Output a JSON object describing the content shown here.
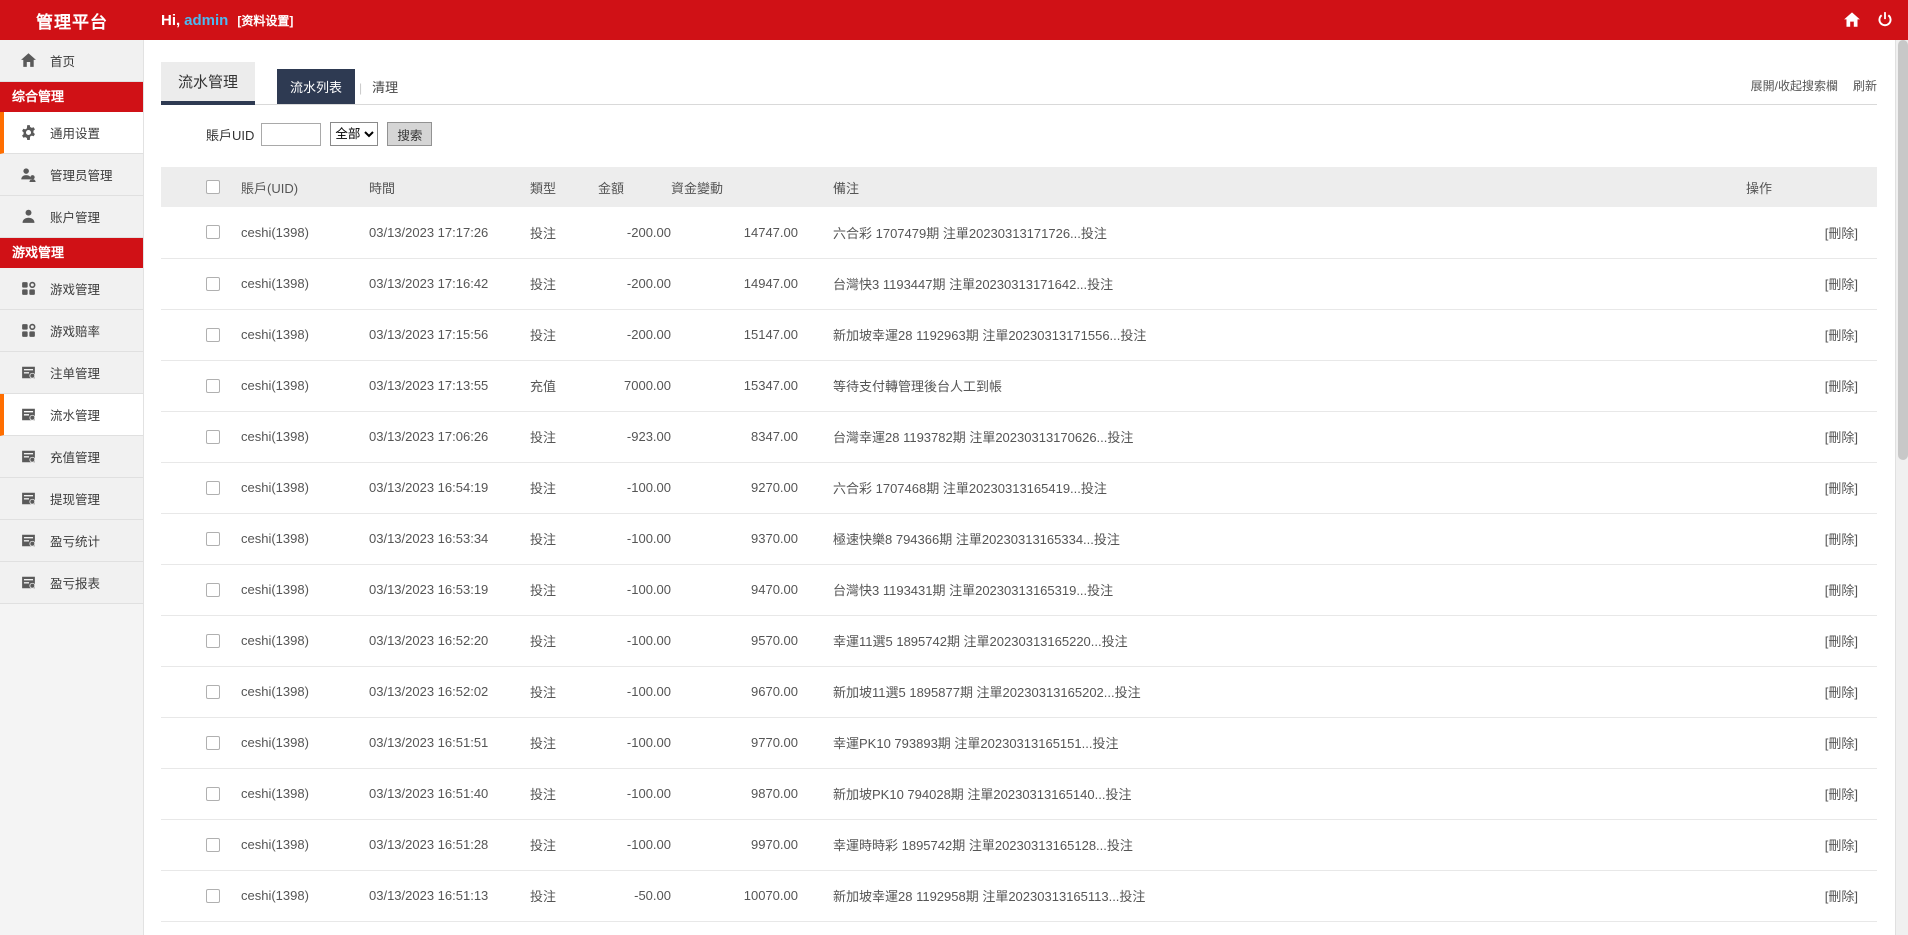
{
  "header": {
    "brand": "管理平台",
    "greeting_prefix": "Hi,",
    "username": "admin",
    "profile_link": "[资料设置]"
  },
  "sidebar": {
    "items": [
      {
        "type": "item",
        "label": "首页",
        "icon": "home-icon",
        "active": false
      },
      {
        "type": "section",
        "label": "综合管理"
      },
      {
        "type": "item",
        "label": "通用设置",
        "icon": "gear-icon",
        "active": true
      },
      {
        "type": "item",
        "label": "管理员管理",
        "icon": "admins-icon",
        "active": false
      },
      {
        "type": "item",
        "label": "账户管理",
        "icon": "user-icon",
        "active": false
      },
      {
        "type": "section",
        "label": "游戏管理"
      },
      {
        "type": "item",
        "label": "游戏管理",
        "icon": "apps-icon",
        "active": false
      },
      {
        "type": "item",
        "label": "游戏赔率",
        "icon": "apps-icon",
        "active": false
      },
      {
        "type": "item",
        "label": "注单管理",
        "icon": "report-icon",
        "active": false
      },
      {
        "type": "item",
        "label": "流水管理",
        "icon": "report-icon",
        "active": true
      },
      {
        "type": "item",
        "label": "充值管理",
        "icon": "report-icon",
        "active": false
      },
      {
        "type": "item",
        "label": "提现管理",
        "icon": "report-icon",
        "active": false
      },
      {
        "type": "item",
        "label": "盈亏统计",
        "icon": "report-icon",
        "active": false
      },
      {
        "type": "item",
        "label": "盈亏报表",
        "icon": "report-icon",
        "active": false
      }
    ]
  },
  "page": {
    "title": "流水管理",
    "tabs": [
      {
        "label": "流水列表",
        "active": true
      },
      {
        "label": "清理",
        "active": false
      }
    ],
    "toolbar": {
      "toggle_search": "展開/收起搜索欄",
      "refresh": "刷新"
    }
  },
  "search": {
    "uid_label": "賬戶UID",
    "uid_value": "",
    "type_selected": "全部",
    "submit_label": "搜索"
  },
  "table": {
    "columns": [
      "賬戶(UID)",
      "時間",
      "類型",
      "金額",
      "資金變動",
      "備注",
      "操作"
    ],
    "action_label": "[刪除]",
    "rows": [
      {
        "account": "ceshi(1398)",
        "time": "03/13/2023 17:17:26",
        "type": "投注",
        "type_kind": "bet",
        "amount": "-200.00",
        "balance": "14747.00",
        "remark": "六合彩 1707479期 注單20230313171726...投注"
      },
      {
        "account": "ceshi(1398)",
        "time": "03/13/2023 17:16:42",
        "type": "投注",
        "type_kind": "bet",
        "amount": "-200.00",
        "balance": "14947.00",
        "remark": "台灣快3 1193447期 注單20230313171642...投注"
      },
      {
        "account": "ceshi(1398)",
        "time": "03/13/2023 17:15:56",
        "type": "投注",
        "type_kind": "bet",
        "amount": "-200.00",
        "balance": "15147.00",
        "remark": "新加坡幸運28 1192963期 注單20230313171556...投注"
      },
      {
        "account": "ceshi(1398)",
        "time": "03/13/2023 17:13:55",
        "type": "充值",
        "type_kind": "recharge",
        "amount": "7000.00",
        "balance": "15347.00",
        "remark": "等待支付轉管理後台人工到帳"
      },
      {
        "account": "ceshi(1398)",
        "time": "03/13/2023 17:06:26",
        "type": "投注",
        "type_kind": "bet",
        "amount": "-923.00",
        "balance": "8347.00",
        "remark": "台灣幸運28 1193782期 注單20230313170626...投注"
      },
      {
        "account": "ceshi(1398)",
        "time": "03/13/2023 16:54:19",
        "type": "投注",
        "type_kind": "bet",
        "amount": "-100.00",
        "balance": "9270.00",
        "remark": "六合彩 1707468期 注單20230313165419...投注"
      },
      {
        "account": "ceshi(1398)",
        "time": "03/13/2023 16:53:34",
        "type": "投注",
        "type_kind": "bet",
        "amount": "-100.00",
        "balance": "9370.00",
        "remark": "極速快樂8 794366期 注單20230313165334...投注"
      },
      {
        "account": "ceshi(1398)",
        "time": "03/13/2023 16:53:19",
        "type": "投注",
        "type_kind": "bet",
        "amount": "-100.00",
        "balance": "9470.00",
        "remark": "台灣快3 1193431期 注單20230313165319...投注"
      },
      {
        "account": "ceshi(1398)",
        "time": "03/13/2023 16:52:20",
        "type": "投注",
        "type_kind": "bet",
        "amount": "-100.00",
        "balance": "9570.00",
        "remark": "幸運11選5 1895742期 注單20230313165220...投注"
      },
      {
        "account": "ceshi(1398)",
        "time": "03/13/2023 16:52:02",
        "type": "投注",
        "type_kind": "bet",
        "amount": "-100.00",
        "balance": "9670.00",
        "remark": "新加坡11選5 1895877期 注單20230313165202...投注"
      },
      {
        "account": "ceshi(1398)",
        "time": "03/13/2023 16:51:51",
        "type": "投注",
        "type_kind": "bet",
        "amount": "-100.00",
        "balance": "9770.00",
        "remark": "幸運PK10 793893期 注單20230313165151...投注"
      },
      {
        "account": "ceshi(1398)",
        "time": "03/13/2023 16:51:40",
        "type": "投注",
        "type_kind": "bet",
        "amount": "-100.00",
        "balance": "9870.00",
        "remark": "新加坡PK10 794028期 注單20230313165140...投注"
      },
      {
        "account": "ceshi(1398)",
        "time": "03/13/2023 16:51:28",
        "type": "投注",
        "type_kind": "bet",
        "amount": "-100.00",
        "balance": "9970.00",
        "remark": "幸運時時彩 1895742期 注單20230313165128...投注"
      },
      {
        "account": "ceshi(1398)",
        "time": "03/13/2023 16:51:13",
        "type": "投注",
        "type_kind": "bet",
        "amount": "-50.00",
        "balance": "10070.00",
        "remark": "新加坡幸運28 1192958期 注單20230313165113...投注"
      }
    ]
  },
  "colors": {
    "accent_red": "#d01116",
    "tab_navy": "#2e3a52",
    "active_orange": "#ff6e00",
    "bet_green": "#22a222",
    "recharge_orange": "#f39800",
    "link_blue": "#4db8f0"
  }
}
